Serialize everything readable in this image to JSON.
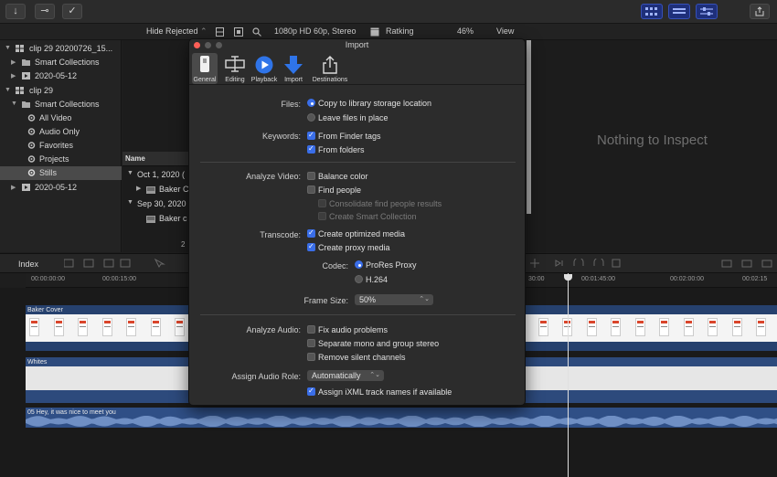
{
  "toolbar": {
    "download_icon": "↓",
    "key_icon": "⊸",
    "check_icon": "✓"
  },
  "subbar": {
    "hide_rejected": "Hide Rejected",
    "format": "1080p HD 60p, Stereo",
    "ratking": "Ratking",
    "zoom": "46%",
    "view": "View"
  },
  "sidebar": {
    "items": [
      {
        "label": "clip 29 20200726_15..."
      },
      {
        "label": "Smart Collections"
      },
      {
        "label": "2020-05-12"
      },
      {
        "label": "clip 29"
      },
      {
        "label": "Smart Collections"
      },
      {
        "label": "All Video"
      },
      {
        "label": "Audio Only"
      },
      {
        "label": "Favorites"
      },
      {
        "label": "Projects"
      },
      {
        "label": "Stills"
      },
      {
        "label": "2020-05-12"
      }
    ]
  },
  "browser": {
    "col_name": "Name",
    "groups": [
      {
        "date": "Oct 1, 2020  (",
        "clip": "Baker C"
      },
      {
        "date": "Sep 30, 2020",
        "clip": "Baker c"
      }
    ],
    "footer": "2"
  },
  "viewer": {
    "empty_text": "Nothing to Inspect"
  },
  "timeline": {
    "index_label": "Index",
    "ruler": [
      "00:00:00:00",
      "00:00:15:00",
      "30:00",
      "00:01:45:00",
      "00:02:00:00",
      "00:02:15"
    ],
    "clips": {
      "baker": "Baker Cover",
      "whites": "Whites",
      "audio": "05 Hey, it was nice to meet you"
    }
  },
  "dialog": {
    "title": "Import",
    "tabs": [
      {
        "label": "General"
      },
      {
        "label": "Editing"
      },
      {
        "label": "Playback"
      },
      {
        "label": "Import"
      },
      {
        "label": "Destinations"
      }
    ],
    "files_label": "Files:",
    "files_copy": "Copy to library storage location",
    "files_leave": "Leave files in place",
    "keywords_label": "Keywords:",
    "kw_finder": "From Finder tags",
    "kw_folders": "From folders",
    "analyze_video_label": "Analyze Video:",
    "balance_color": "Balance color",
    "find_people": "Find people",
    "consolidate": "Consolidate find people results",
    "smart_collection": "Create Smart Collection",
    "transcode_label": "Transcode:",
    "optimized": "Create optimized media",
    "proxy": "Create proxy media",
    "codec_label": "Codec:",
    "codec_prores": "ProRes Proxy",
    "codec_h264": "H.264",
    "frame_size_label": "Frame Size:",
    "frame_size_value": "50%",
    "analyze_audio_label": "Analyze Audio:",
    "fix_audio": "Fix audio problems",
    "separate_mono": "Separate mono and group stereo",
    "remove_silent": "Remove silent channels",
    "audio_role_label": "Assign Audio Role:",
    "audio_role_value": "Automatically",
    "ixml": "Assign iXML track names if available"
  }
}
